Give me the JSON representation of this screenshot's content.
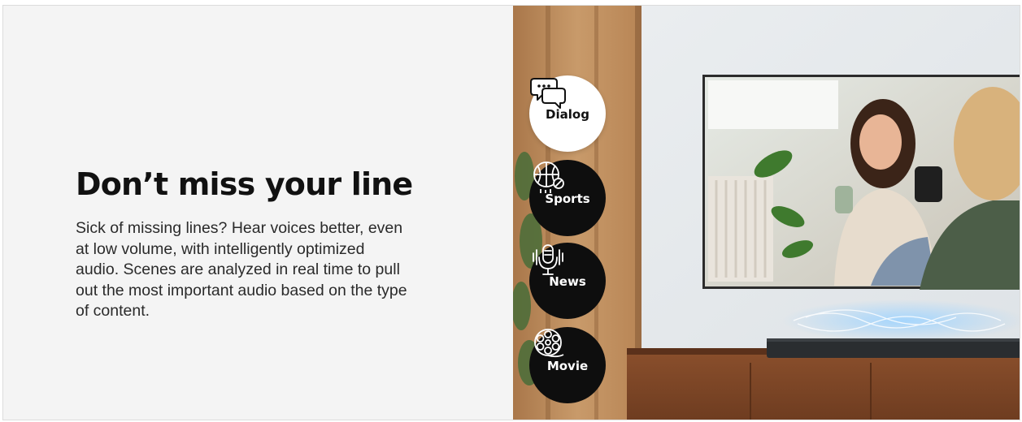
{
  "feature": {
    "headline": "Don’t miss your line",
    "description": "Sick of missing lines? Hear voices better, even at low volume, with intelligently optimized audio. Scenes are analyzed in real time to pull out the most important audio based on the type of content."
  },
  "sound_modes": [
    {
      "label": "Dialog",
      "icon": "dialog-bubbles-icon",
      "active": true
    },
    {
      "label": "Sports",
      "icon": "basketball-icon",
      "active": false
    },
    {
      "label": "News",
      "icon": "microphone-icon",
      "active": false
    },
    {
      "label": "Movie",
      "icon": "film-reel-icon",
      "active": false
    }
  ],
  "colors": {
    "panel_background": "#f4f4f4",
    "headline": "#111111",
    "body_text": "#2a2a2a",
    "mode_active_bg": "#ffffff",
    "mode_inactive_bg": "#0e0e0e"
  }
}
